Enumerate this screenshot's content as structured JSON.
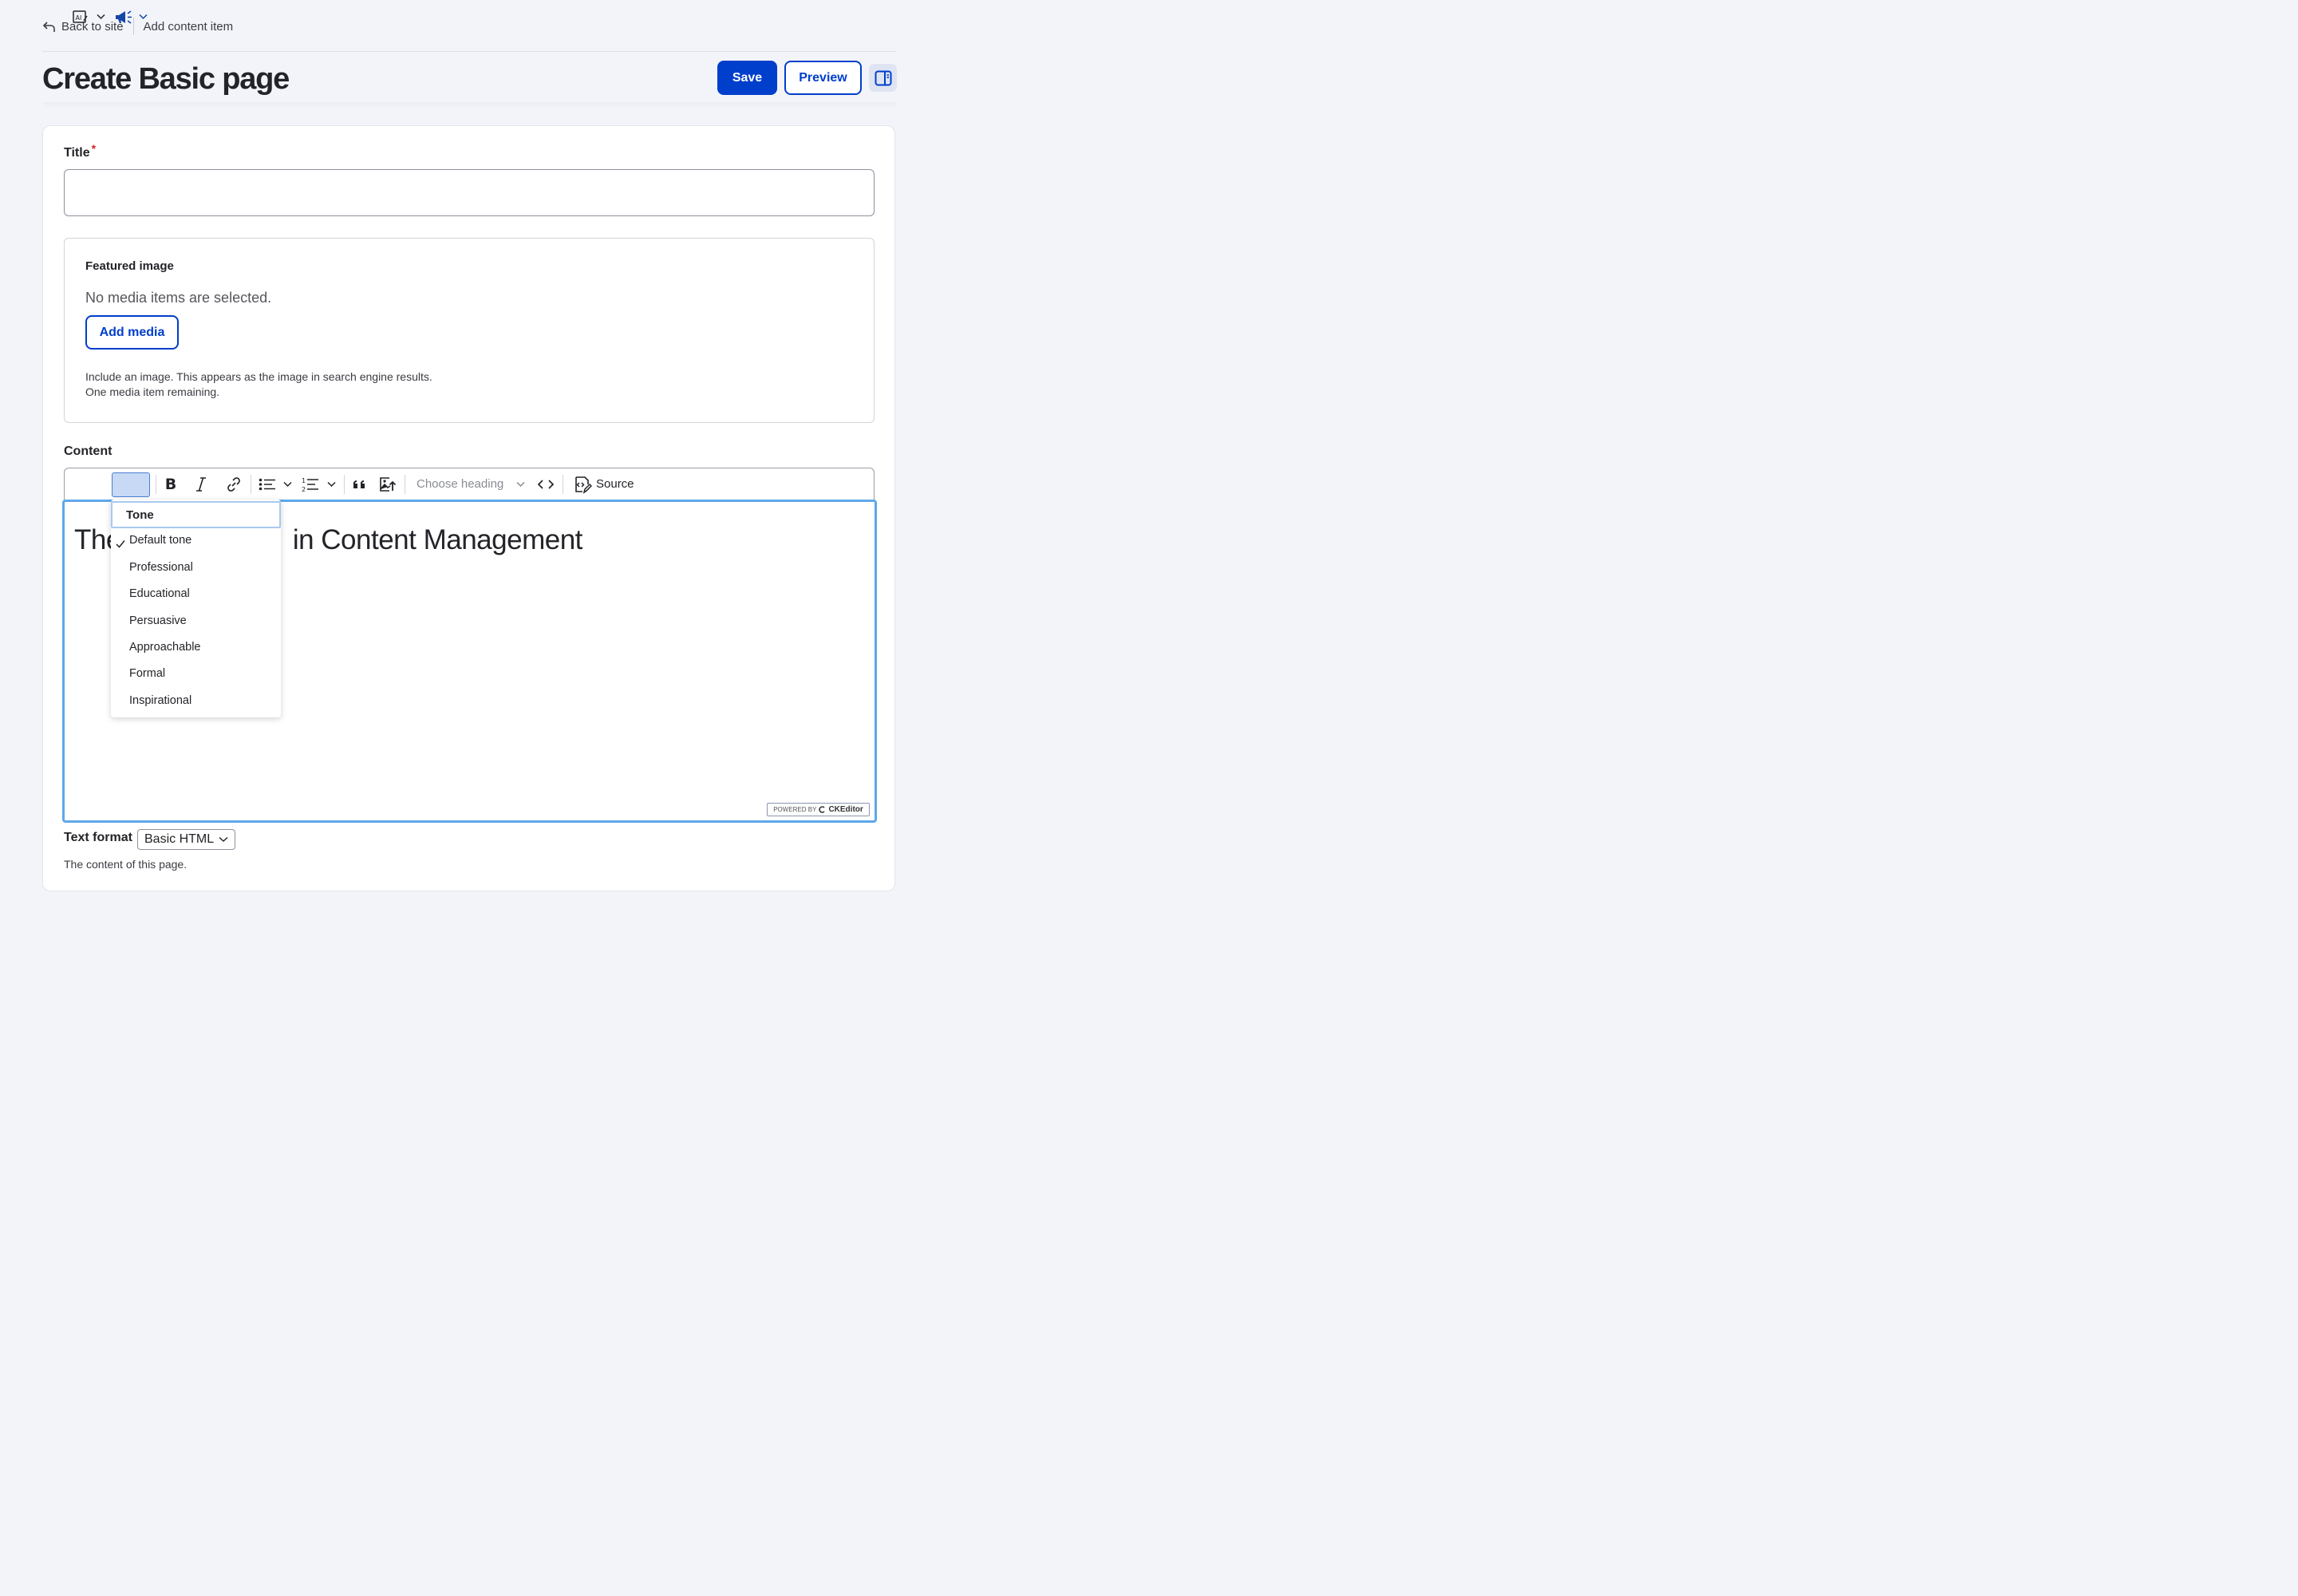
{
  "topbar": {
    "back_label": "Back to site",
    "breadcrumb": "Add content item"
  },
  "header": {
    "title": "Create Basic page",
    "save_label": "Save",
    "preview_label": "Preview"
  },
  "form": {
    "title_label": "Title",
    "required_mark": "*",
    "featured_image": {
      "legend": "Featured image",
      "empty_text": "No media items are selected.",
      "add_media_label": "Add media",
      "description_line1": "Include an image. This appears as the image in search engine results.",
      "description_line2": "One media item remaining."
    },
    "content_label": "Content",
    "toolbar": {
      "heading_placeholder": "Choose heading",
      "source_label": "Source"
    },
    "editor": {
      "heading_start": "The",
      "heading_end": "in Content Management",
      "powered_prefix": "POWERED BY",
      "powered_brand": "CKEditor"
    },
    "tone_dropdown": {
      "header": "Tone",
      "selected": "Default tone",
      "items": [
        "Default tone",
        "Professional",
        "Educational",
        "Persuasive",
        "Approachable",
        "Formal",
        "Inspirational"
      ]
    },
    "text_format_label": "Text format",
    "text_format_value": "Basic HTML",
    "help_text": "The content of this page."
  },
  "colors": {
    "primary": "#003ecc",
    "focus_ring": "#5ea8ea",
    "required": "#d72222"
  }
}
